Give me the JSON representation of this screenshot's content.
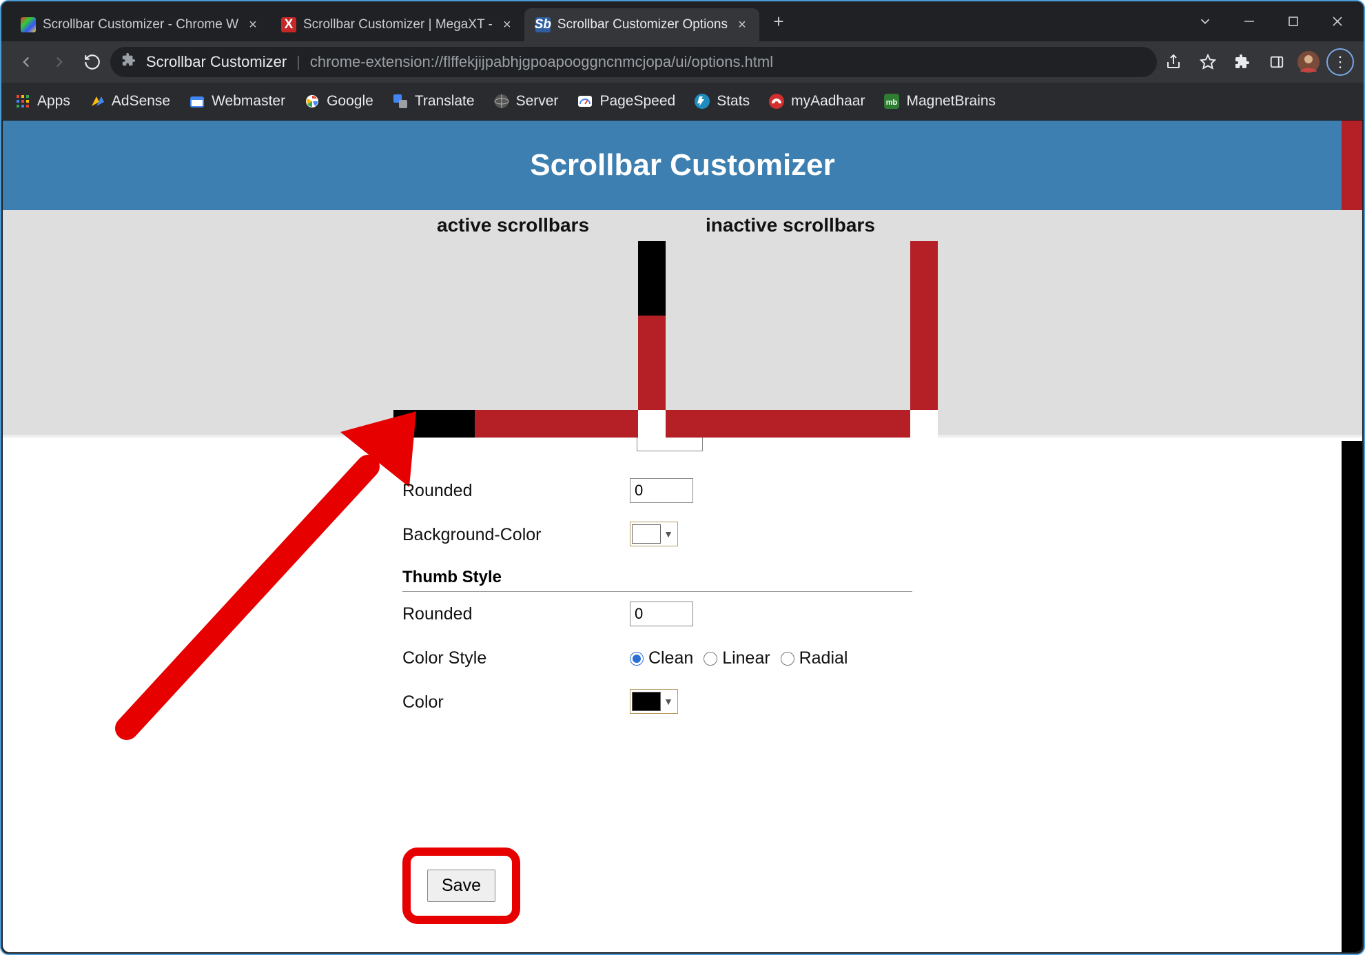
{
  "window": {
    "tabs": [
      {
        "title": "Scrollbar Customizer - Chrome W",
        "favicon": "rainbow"
      },
      {
        "title": "Scrollbar Customizer | MegaXT - ",
        "favicon": "red-x"
      },
      {
        "title": "Scrollbar Customizer Options",
        "favicon": "sb-blue",
        "active": true
      }
    ],
    "newtab": "+"
  },
  "address": {
    "ext_name": "Scrollbar Customizer",
    "url": "chrome-extension://flffekjijpabhjgpoapooggncnmcjopa/ui/options.html"
  },
  "bookmarks": [
    {
      "label": "Apps",
      "icon": "apps"
    },
    {
      "label": "AdSense",
      "icon": "adsense"
    },
    {
      "label": "Webmaster",
      "icon": "webmaster"
    },
    {
      "label": "Google",
      "icon": "google"
    },
    {
      "label": "Translate",
      "icon": "translate"
    },
    {
      "label": "Server",
      "icon": "server"
    },
    {
      "label": "PageSpeed",
      "icon": "pagespeed"
    },
    {
      "label": "Stats",
      "icon": "stats"
    },
    {
      "label": "myAadhaar",
      "icon": "aadhaar"
    },
    {
      "label": "MagnetBrains",
      "icon": "mb"
    }
  ],
  "page": {
    "title": "Scrollbar Customizer",
    "preview": {
      "active_label": "active scrollbars",
      "inactive_label": "inactive scrollbars"
    },
    "form": {
      "rounded1_label": "Rounded",
      "rounded1_value": "0",
      "bgcolor_label": "Background-Color",
      "bgcolor_value": "#ffffff",
      "thumb_section": "Thumb Style",
      "rounded2_label": "Rounded",
      "rounded2_value": "0",
      "colorstyle_label": "Color Style",
      "colorstyle_options": {
        "clean": "Clean",
        "linear": "Linear",
        "radial": "Radial"
      },
      "colorstyle_selected": "clean",
      "color_label": "Color",
      "color_value": "#000000",
      "save_label": "Save"
    }
  },
  "colors": {
    "accent_red": "#b42025",
    "header_blue": "#3d7fb0",
    "annotation_red": "#e60000"
  }
}
